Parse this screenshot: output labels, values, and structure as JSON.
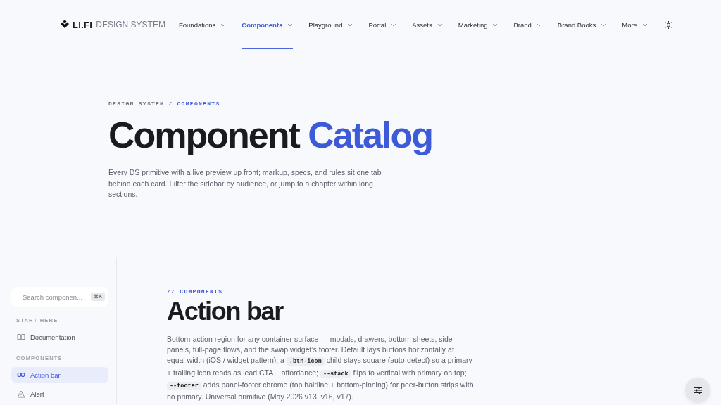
{
  "header": {
    "logo": {
      "brand": "LI.FI",
      "product": "DESIGN SYSTEM"
    },
    "nav": [
      {
        "label": "Foundations",
        "selected": false
      },
      {
        "label": "Components",
        "selected": true
      },
      {
        "label": "Playground",
        "selected": false
      },
      {
        "label": "Portal",
        "selected": false
      },
      {
        "label": "Assets",
        "selected": false
      },
      {
        "label": "Marketing",
        "selected": false
      },
      {
        "label": "Brand",
        "selected": false
      },
      {
        "label": "Brand Books",
        "selected": false
      },
      {
        "label": "More",
        "selected": false
      }
    ]
  },
  "hero": {
    "breadcrumb": {
      "parent": "DESIGN SYSTEM",
      "current": "/ COMPONENTS"
    },
    "title": [
      {
        "text": "Component",
        "accent": false
      },
      {
        "text": "Catalog",
        "accent": true
      }
    ],
    "description": "Every DS primitive with a live preview up front; markup, specs, and rules sit one tab behind each card. Filter the sidebar by audience, or jump to a chapter within long sections."
  },
  "sidebar": {
    "search": {
      "placeholder": "Search componen...",
      "shortcut": "⌘K"
    },
    "groups": [
      {
        "label": "START HERE",
        "items": [
          {
            "label": "Documentation",
            "kind": "book",
            "selected": false
          }
        ]
      },
      {
        "label": "COMPONENTS",
        "items": [
          {
            "label": "Action bar",
            "kind": "link",
            "selected": true
          },
          {
            "label": "Alert",
            "kind": "warning",
            "selected": false
          }
        ]
      }
    ]
  },
  "section": {
    "eyebrow": "// COMPONENTS",
    "title": "Action bar",
    "description": [
      {
        "kind": "text",
        "text": "Bottom-action region for any container surface — modals, drawers, bottom sheets, side panels, full-page flows, and the swap widget’s footer. Default lays buttons horizontally at equal width (iOS / widget pattern); a "
      },
      {
        "kind": "code",
        "text": ".btn-icon"
      },
      {
        "kind": "text",
        "text": " child stays square (auto-detect) so a primary + trailing icon reads as lead CTA + affordance; "
      },
      {
        "kind": "code",
        "text": "--stack"
      },
      {
        "kind": "text",
        "text": " flips to vertical with primary on top; "
      },
      {
        "kind": "code",
        "text": "--footer"
      },
      {
        "kind": "text",
        "text": " adds panel-footer chrome (top hairline + bottom-pinning) for peer-button strips with no primary. Universal primitive (May 2026 v13, v16, v17)."
      }
    ]
  }
}
